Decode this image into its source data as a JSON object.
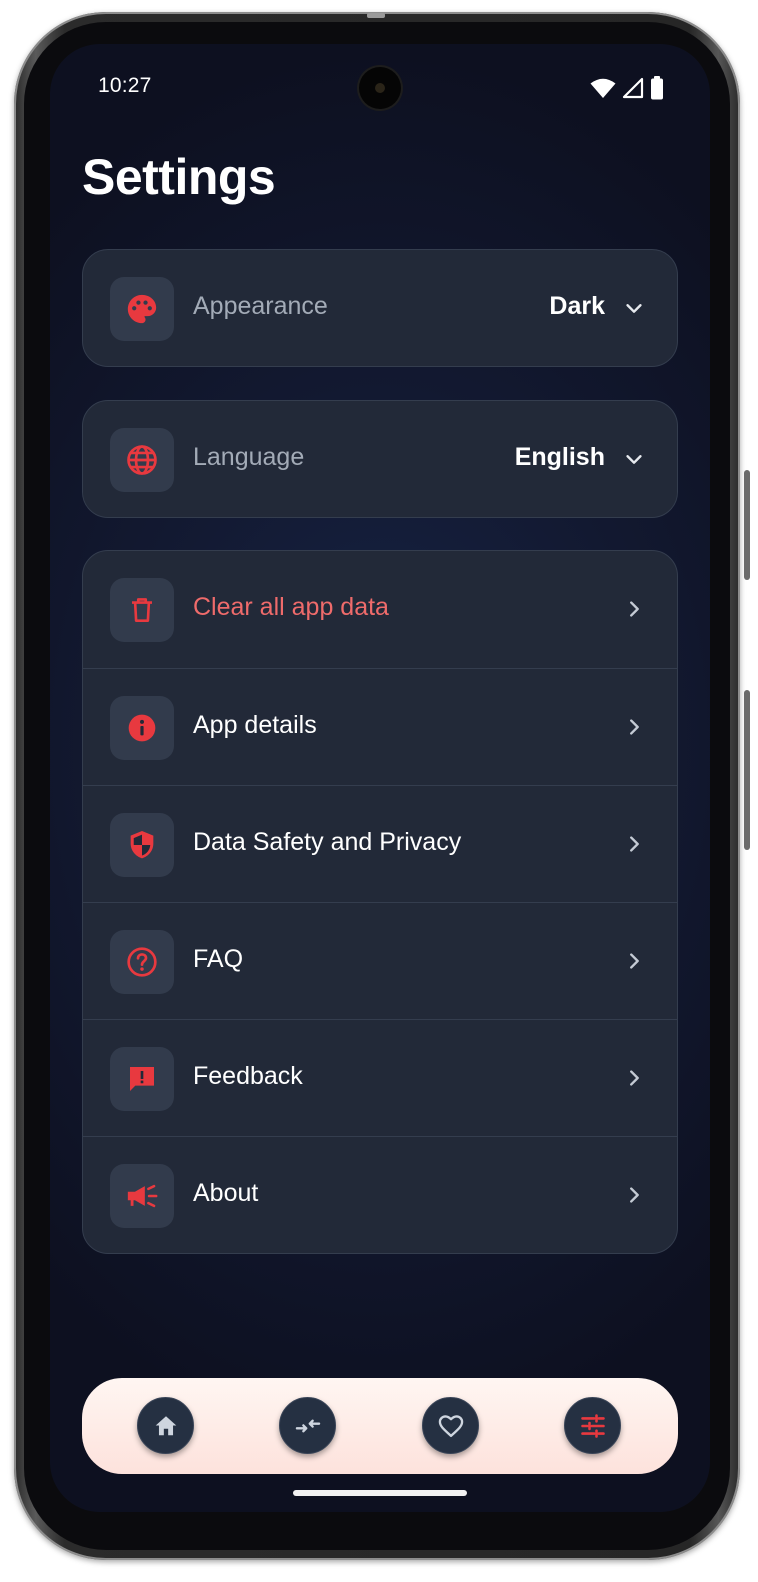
{
  "status_bar": {
    "time": "10:27"
  },
  "page": {
    "title": "Settings"
  },
  "preferences": {
    "appearance": {
      "label": "Appearance",
      "value": "Dark",
      "icon": "palette-icon"
    },
    "language": {
      "label": "Language",
      "value": "English",
      "icon": "globe-icon"
    }
  },
  "menu": {
    "items": [
      {
        "label": "Clear all app data",
        "icon": "trash-icon",
        "style": "danger"
      },
      {
        "label": "App details",
        "icon": "info-icon"
      },
      {
        "label": "Data Safety and Privacy",
        "icon": "shield-icon"
      },
      {
        "label": "FAQ",
        "icon": "question-icon"
      },
      {
        "label": "Feedback",
        "icon": "feedback-icon"
      },
      {
        "label": "About",
        "icon": "megaphone-icon"
      }
    ]
  },
  "bottom_nav": {
    "items": [
      {
        "icon": "home-icon"
      },
      {
        "icon": "compare-arrows-icon"
      },
      {
        "icon": "heart-icon"
      },
      {
        "icon": "sliders-icon",
        "active": true
      }
    ]
  },
  "colors": {
    "accent": "#e8393f",
    "danger_text": "#ef6b6b",
    "card_bg": "#222938",
    "nav_bg": "#fde7e1"
  }
}
